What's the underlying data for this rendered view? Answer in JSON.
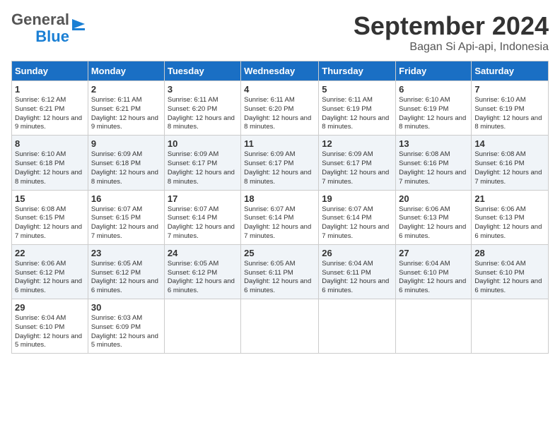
{
  "header": {
    "logo_text_general": "General",
    "logo_text_blue": "Blue",
    "title": "September 2024",
    "subtitle": "Bagan Si Api-api, Indonesia"
  },
  "calendar": {
    "days_of_week": [
      "Sunday",
      "Monday",
      "Tuesday",
      "Wednesday",
      "Thursday",
      "Friday",
      "Saturday"
    ],
    "weeks": [
      [
        {
          "day": "1",
          "sunrise": "Sunrise: 6:12 AM",
          "sunset": "Sunset: 6:21 PM",
          "daylight": "Daylight: 12 hours and 9 minutes."
        },
        {
          "day": "2",
          "sunrise": "Sunrise: 6:11 AM",
          "sunset": "Sunset: 6:21 PM",
          "daylight": "Daylight: 12 hours and 9 minutes."
        },
        {
          "day": "3",
          "sunrise": "Sunrise: 6:11 AM",
          "sunset": "Sunset: 6:20 PM",
          "daylight": "Daylight: 12 hours and 8 minutes."
        },
        {
          "day": "4",
          "sunrise": "Sunrise: 6:11 AM",
          "sunset": "Sunset: 6:20 PM",
          "daylight": "Daylight: 12 hours and 8 minutes."
        },
        {
          "day": "5",
          "sunrise": "Sunrise: 6:11 AM",
          "sunset": "Sunset: 6:19 PM",
          "daylight": "Daylight: 12 hours and 8 minutes."
        },
        {
          "day": "6",
          "sunrise": "Sunrise: 6:10 AM",
          "sunset": "Sunset: 6:19 PM",
          "daylight": "Daylight: 12 hours and 8 minutes."
        },
        {
          "day": "7",
          "sunrise": "Sunrise: 6:10 AM",
          "sunset": "Sunset: 6:19 PM",
          "daylight": "Daylight: 12 hours and 8 minutes."
        }
      ],
      [
        {
          "day": "8",
          "sunrise": "Sunrise: 6:10 AM",
          "sunset": "Sunset: 6:18 PM",
          "daylight": "Daylight: 12 hours and 8 minutes."
        },
        {
          "day": "9",
          "sunrise": "Sunrise: 6:09 AM",
          "sunset": "Sunset: 6:18 PM",
          "daylight": "Daylight: 12 hours and 8 minutes."
        },
        {
          "day": "10",
          "sunrise": "Sunrise: 6:09 AM",
          "sunset": "Sunset: 6:17 PM",
          "daylight": "Daylight: 12 hours and 8 minutes."
        },
        {
          "day": "11",
          "sunrise": "Sunrise: 6:09 AM",
          "sunset": "Sunset: 6:17 PM",
          "daylight": "Daylight: 12 hours and 8 minutes."
        },
        {
          "day": "12",
          "sunrise": "Sunrise: 6:09 AM",
          "sunset": "Sunset: 6:17 PM",
          "daylight": "Daylight: 12 hours and 7 minutes."
        },
        {
          "day": "13",
          "sunrise": "Sunrise: 6:08 AM",
          "sunset": "Sunset: 6:16 PM",
          "daylight": "Daylight: 12 hours and 7 minutes."
        },
        {
          "day": "14",
          "sunrise": "Sunrise: 6:08 AM",
          "sunset": "Sunset: 6:16 PM",
          "daylight": "Daylight: 12 hours and 7 minutes."
        }
      ],
      [
        {
          "day": "15",
          "sunrise": "Sunrise: 6:08 AM",
          "sunset": "Sunset: 6:15 PM",
          "daylight": "Daylight: 12 hours and 7 minutes."
        },
        {
          "day": "16",
          "sunrise": "Sunrise: 6:07 AM",
          "sunset": "Sunset: 6:15 PM",
          "daylight": "Daylight: 12 hours and 7 minutes."
        },
        {
          "day": "17",
          "sunrise": "Sunrise: 6:07 AM",
          "sunset": "Sunset: 6:14 PM",
          "daylight": "Daylight: 12 hours and 7 minutes."
        },
        {
          "day": "18",
          "sunrise": "Sunrise: 6:07 AM",
          "sunset": "Sunset: 6:14 PM",
          "daylight": "Daylight: 12 hours and 7 minutes."
        },
        {
          "day": "19",
          "sunrise": "Sunrise: 6:07 AM",
          "sunset": "Sunset: 6:14 PM",
          "daylight": "Daylight: 12 hours and 7 minutes."
        },
        {
          "day": "20",
          "sunrise": "Sunrise: 6:06 AM",
          "sunset": "Sunset: 6:13 PM",
          "daylight": "Daylight: 12 hours and 6 minutes."
        },
        {
          "day": "21",
          "sunrise": "Sunrise: 6:06 AM",
          "sunset": "Sunset: 6:13 PM",
          "daylight": "Daylight: 12 hours and 6 minutes."
        }
      ],
      [
        {
          "day": "22",
          "sunrise": "Sunrise: 6:06 AM",
          "sunset": "Sunset: 6:12 PM",
          "daylight": "Daylight: 12 hours and 6 minutes."
        },
        {
          "day": "23",
          "sunrise": "Sunrise: 6:05 AM",
          "sunset": "Sunset: 6:12 PM",
          "daylight": "Daylight: 12 hours and 6 minutes."
        },
        {
          "day": "24",
          "sunrise": "Sunrise: 6:05 AM",
          "sunset": "Sunset: 6:12 PM",
          "daylight": "Daylight: 12 hours and 6 minutes."
        },
        {
          "day": "25",
          "sunrise": "Sunrise: 6:05 AM",
          "sunset": "Sunset: 6:11 PM",
          "daylight": "Daylight: 12 hours and 6 minutes."
        },
        {
          "day": "26",
          "sunrise": "Sunrise: 6:04 AM",
          "sunset": "Sunset: 6:11 PM",
          "daylight": "Daylight: 12 hours and 6 minutes."
        },
        {
          "day": "27",
          "sunrise": "Sunrise: 6:04 AM",
          "sunset": "Sunset: 6:10 PM",
          "daylight": "Daylight: 12 hours and 6 minutes."
        },
        {
          "day": "28",
          "sunrise": "Sunrise: 6:04 AM",
          "sunset": "Sunset: 6:10 PM",
          "daylight": "Daylight: 12 hours and 6 minutes."
        }
      ],
      [
        {
          "day": "29",
          "sunrise": "Sunrise: 6:04 AM",
          "sunset": "Sunset: 6:10 PM",
          "daylight": "Daylight: 12 hours and 5 minutes."
        },
        {
          "day": "30",
          "sunrise": "Sunrise: 6:03 AM",
          "sunset": "Sunset: 6:09 PM",
          "daylight": "Daylight: 12 hours and 5 minutes."
        },
        null,
        null,
        null,
        null,
        null
      ]
    ]
  }
}
